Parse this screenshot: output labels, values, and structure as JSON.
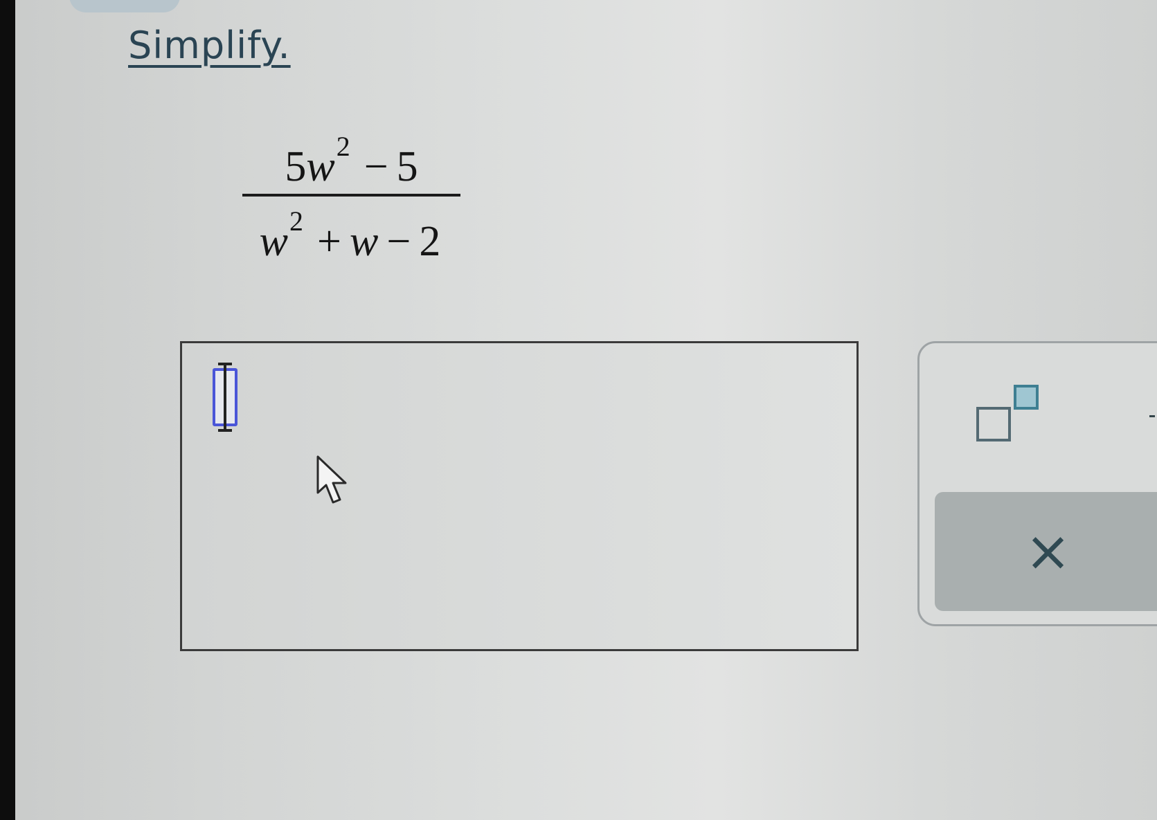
{
  "instruction": {
    "text": "Simplify."
  },
  "expression": {
    "numerator": {
      "coefficient": "5",
      "variable": "w",
      "exponent": "2",
      "operator": "−",
      "constant": "5"
    },
    "denominator": {
      "variable": "w",
      "exponent": "2",
      "operator1": "+",
      "term2": "w",
      "operator2": "−",
      "constant": "2"
    }
  },
  "answer": {
    "value": ""
  },
  "toolbar": {
    "superscript_icon": "superscript-template-icon",
    "clear_label": "×"
  },
  "colors": {
    "link_text": "#2a4453",
    "cursor_slot_border": "#4a55d8",
    "exponent_box_fill": "#9fc6d2",
    "clear_button_bg": "#a9afaf"
  }
}
